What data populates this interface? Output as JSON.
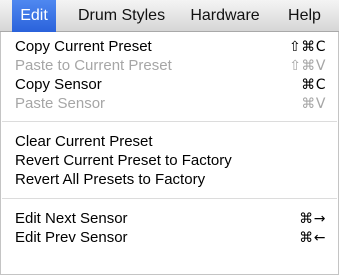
{
  "menubar": {
    "items": [
      {
        "label": "Edit"
      },
      {
        "label": "Drum Styles"
      },
      {
        "label": "Hardware"
      },
      {
        "label": "Help"
      }
    ]
  },
  "edit_menu": {
    "items": [
      {
        "label": "Copy Current Preset",
        "shortcut": "⇧⌘C",
        "enabled": true
      },
      {
        "label": "Paste to Current Preset",
        "shortcut": "⇧⌘V",
        "enabled": false
      },
      {
        "label": "Copy Sensor",
        "shortcut": "⌘C",
        "enabled": true
      },
      {
        "label": "Paste Sensor",
        "shortcut": "⌘V",
        "enabled": false
      },
      {
        "label": "Clear Current Preset",
        "shortcut": "",
        "enabled": true
      },
      {
        "label": "Revert Current Preset to Factory",
        "shortcut": "",
        "enabled": true
      },
      {
        "label": "Revert All Presets to Factory",
        "shortcut": "",
        "enabled": true
      },
      {
        "label": "Edit Next Sensor",
        "shortcut": "⌘→",
        "enabled": true
      },
      {
        "label": "Edit Prev Sensor",
        "shortcut": "⌘←",
        "enabled": true
      }
    ]
  }
}
